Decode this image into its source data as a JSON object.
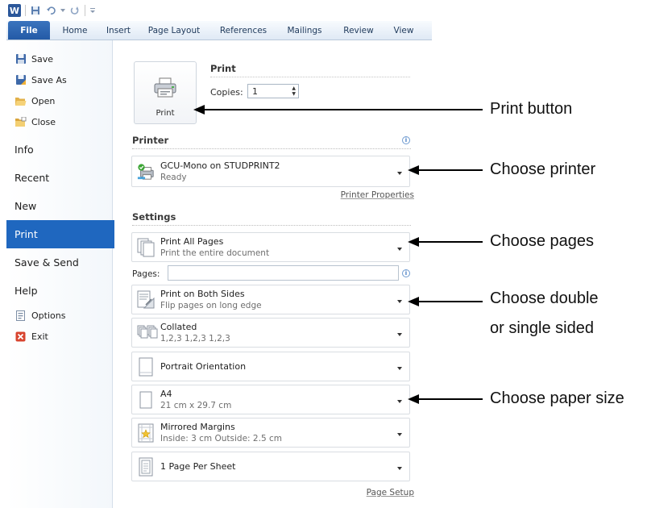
{
  "quick_access": {
    "logo_letter": "W"
  },
  "ribbon": {
    "tabs": [
      "File",
      "Home",
      "Insert",
      "Page Layout",
      "References",
      "Mailings",
      "Review",
      "View"
    ]
  },
  "sidebar": {
    "commands": [
      {
        "label": "Save",
        "icon": "save-icon"
      },
      {
        "label": "Save As",
        "icon": "save-as-icon"
      },
      {
        "label": "Open",
        "icon": "open-folder-icon"
      },
      {
        "label": "Close",
        "icon": "close-folder-icon"
      }
    ],
    "sections": [
      "Info",
      "Recent",
      "New",
      "Print",
      "Save & Send",
      "Help"
    ],
    "active": "Print",
    "bottom": [
      {
        "label": "Options",
        "icon": "options-icon"
      },
      {
        "label": "Exit",
        "icon": "exit-icon"
      }
    ]
  },
  "print": {
    "heading": "Print",
    "button_label": "Print",
    "copies_label": "Copies:",
    "copies_value": "1"
  },
  "printer": {
    "heading": "Printer",
    "name": "GCU-Mono on STUDPRINT2",
    "status": "Ready",
    "properties_link": "Printer Properties"
  },
  "settings": {
    "heading": "Settings",
    "pages_label": "Pages:",
    "items": [
      {
        "line1": "Print All Pages",
        "line2": "Print the entire document",
        "icon": "pages-icon"
      },
      {
        "line1": "Print on Both Sides",
        "line2": "Flip pages on long edge",
        "icon": "duplex-icon"
      },
      {
        "line1": "Collated",
        "line2": "1,2,3   1,2,3   1,2,3",
        "icon": "collated-icon"
      },
      {
        "line1": "Portrait Orientation",
        "line2": "",
        "icon": "portrait-icon"
      },
      {
        "line1": "A4",
        "line2": "21 cm x 29.7 cm",
        "icon": "paper-size-icon"
      },
      {
        "line1": "Mirrored Margins",
        "line2": "Inside:  3 cm    Outside:  2.5 cm",
        "icon": "margins-icon"
      },
      {
        "line1": "1 Page Per Sheet",
        "line2": "",
        "icon": "pages-per-sheet-icon"
      }
    ],
    "page_setup_link": "Page Setup"
  },
  "annotations": [
    "Print button",
    "Choose printer",
    "Choose pages",
    "Choose double",
    "or single sided",
    "Choose paper size"
  ],
  "colors": {
    "file_tab": "#245aa6",
    "active_nav": "#1f67bf",
    "annotation": "#000000"
  }
}
